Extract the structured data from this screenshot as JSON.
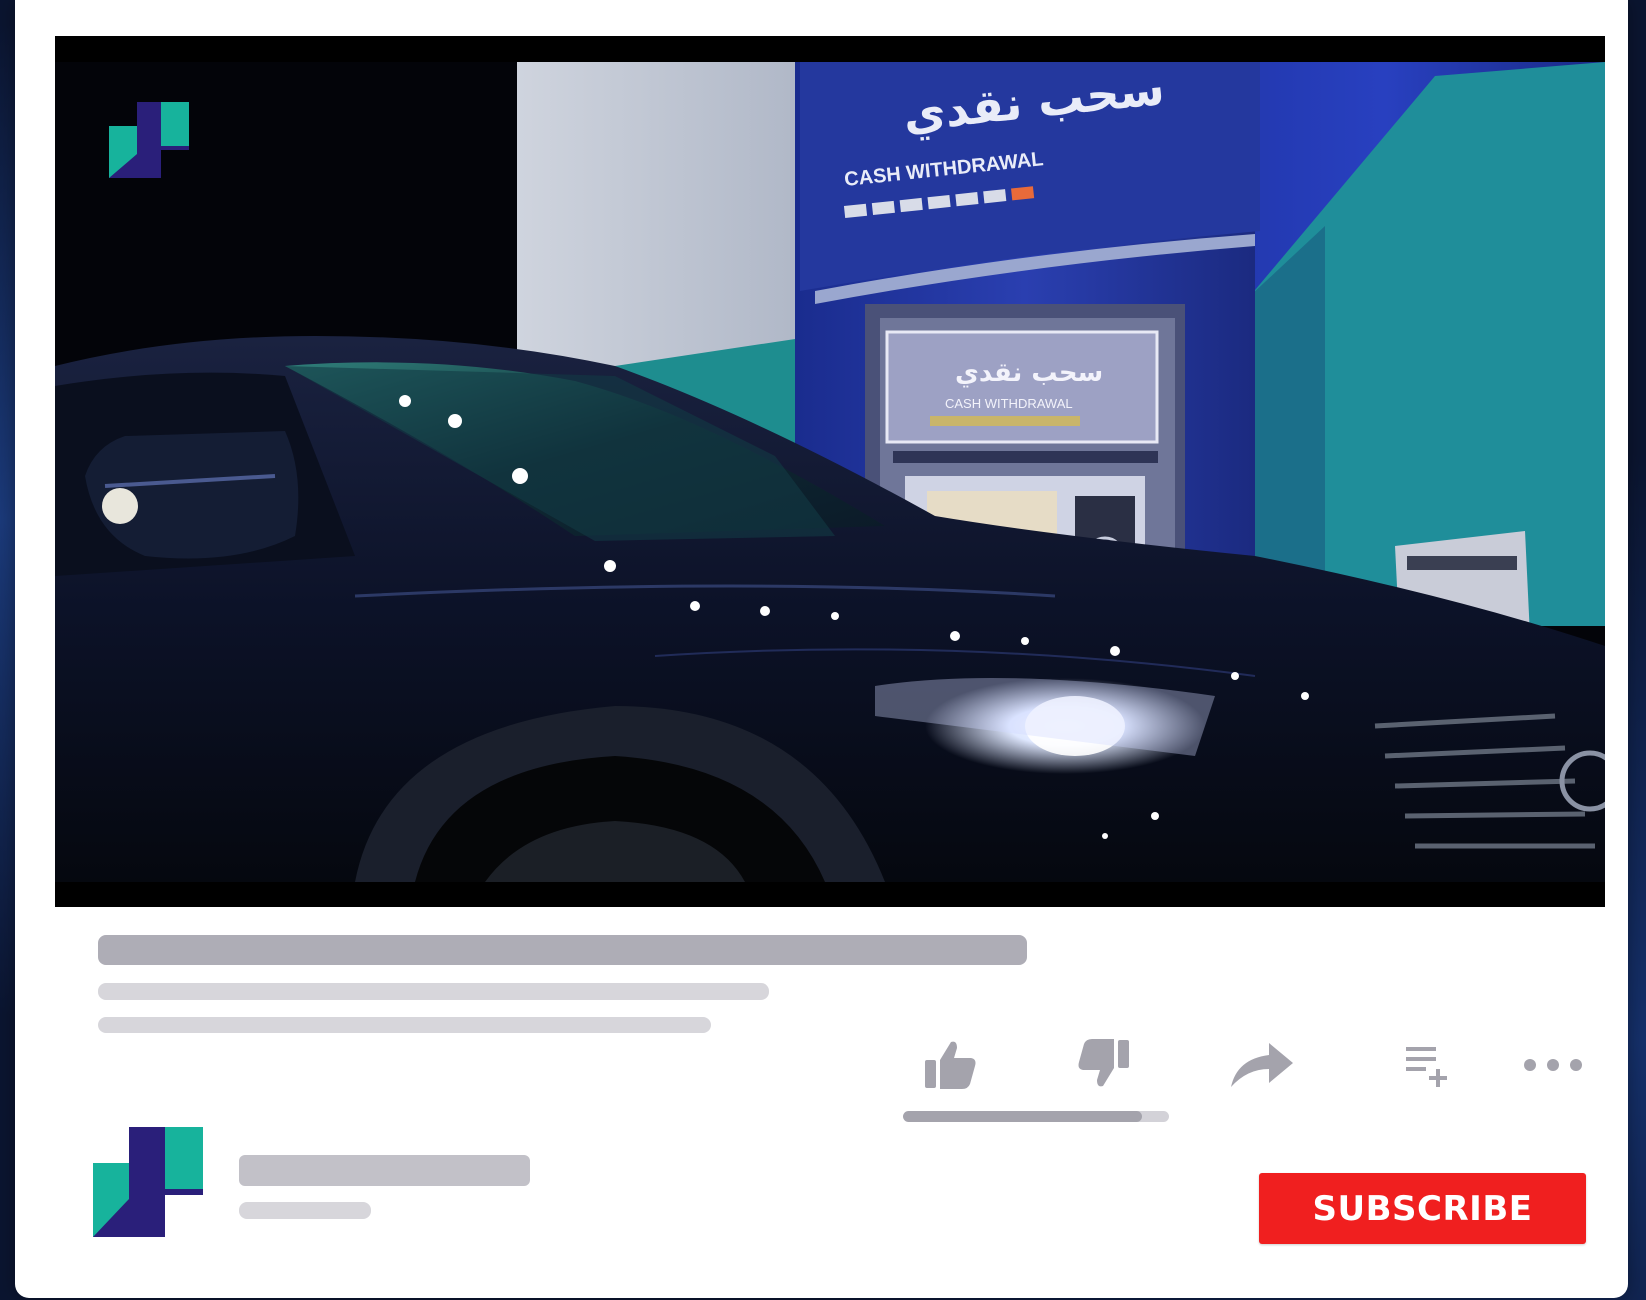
{
  "video": {
    "sign_top_arabic": "سحب نقدي",
    "sign_top_english": "CASH WITHDRAWAL",
    "sign_atm_arabic": "سحب نقدي",
    "sign_atm_english": "CASH WITHDRAWAL"
  },
  "actions": {
    "like_icon": "thumbs-up-icon",
    "dislike_icon": "thumbs-down-icon",
    "share_icon": "share-icon",
    "save_icon": "add-to-playlist-icon",
    "more_icon": "more-icon",
    "like_ratio": 0.9
  },
  "channel": {
    "subscribe_label": "SUBSCRIBE"
  },
  "colors": {
    "subscribe_bg": "#f01f1f",
    "placeholder_dark": "#aeadb6",
    "placeholder_light": "#d7d6db",
    "icon_gray": "#a4a3ac",
    "logo_teal": "#17b39c",
    "logo_navy": "#2a1f7a"
  }
}
